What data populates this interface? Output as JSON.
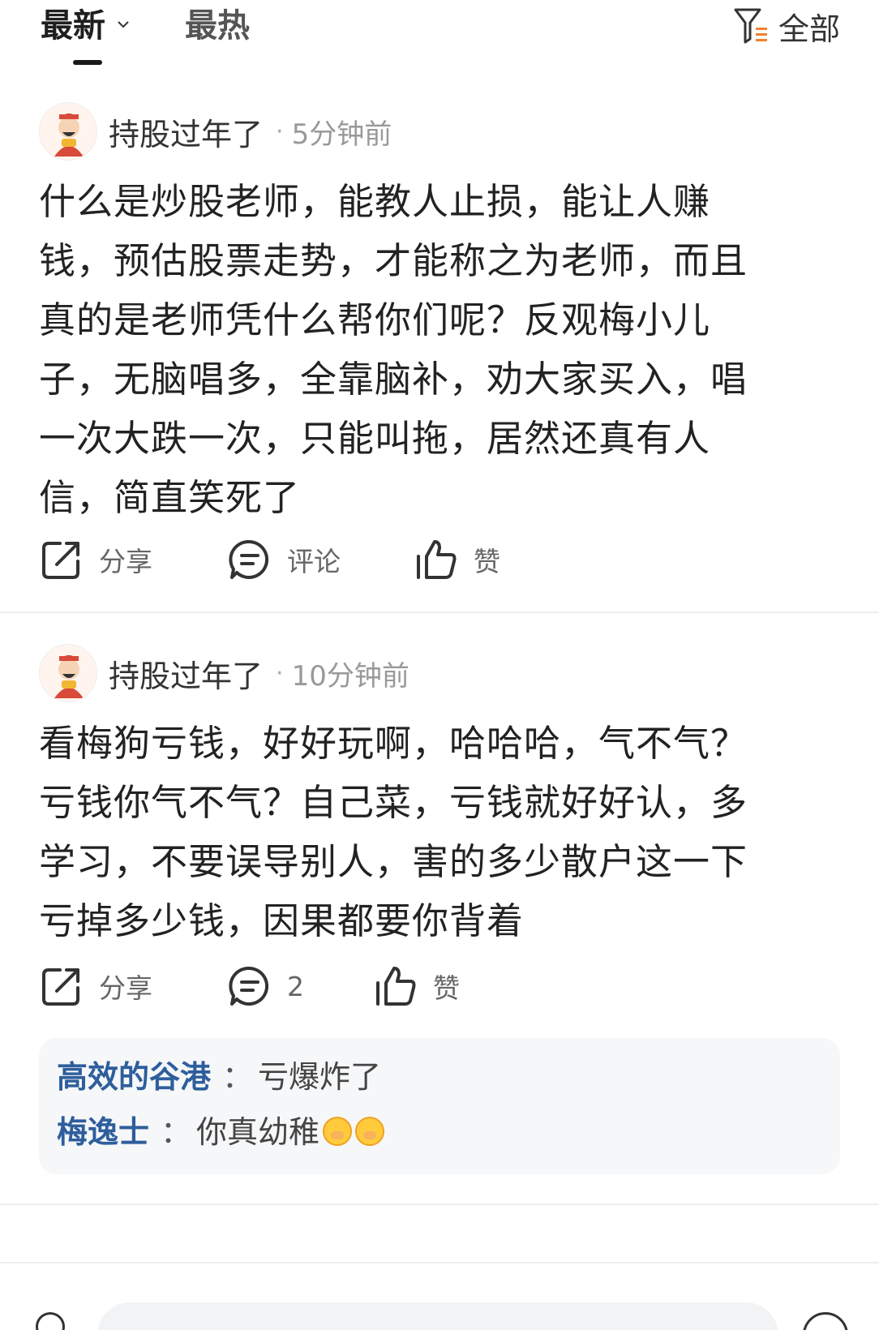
{
  "tabs": {
    "latest": "最新",
    "hot": "最热",
    "filter_label": "全部"
  },
  "colors": {
    "accent_orange": "#f08030",
    "reply_name": "#2e5e9c"
  },
  "posts": [
    {
      "author": "持股过年了",
      "separator": "·",
      "time": "5分钟前",
      "lines": [
        "什么是炒股老师，能教人止损，能让人赚",
        "钱，预估股票走势，才能称之为老师，而且",
        "真的是老师凭什么帮你们呢？反观梅小儿",
        "子，无脑唱多，全靠脑补，劝大家买入，唱",
        "一次大跌一次，只能叫拖，居然还真有人",
        "信，简直笑死了"
      ],
      "share": "分享",
      "comment": "评论",
      "like": "赞"
    },
    {
      "author": "持股过年了",
      "separator": "·",
      "time": "10分钟前",
      "lines": [
        "看梅狗亏钱，好好玩啊，哈哈哈，气不气？",
        "亏钱你气不气？自己菜，亏钱就好好认，多",
        "学习，不要误导别人，害的多少散户这一下",
        "亏掉多少钱，因果都要你背着"
      ],
      "share": "分享",
      "comment": "2",
      "like": "赞",
      "replies": [
        {
          "name": "高效的谷港",
          "colon": "：",
          "text": "亏爆炸了"
        },
        {
          "name": "梅逸士",
          "colon": "：",
          "text": "你真幼稚"
        }
      ]
    }
  ],
  "icons": {
    "filter": "filter-icon",
    "share": "share-icon",
    "comment": "comment-icon",
    "like": "thumbs-up-icon",
    "emoji": "hand-over-mouth-emoji"
  }
}
